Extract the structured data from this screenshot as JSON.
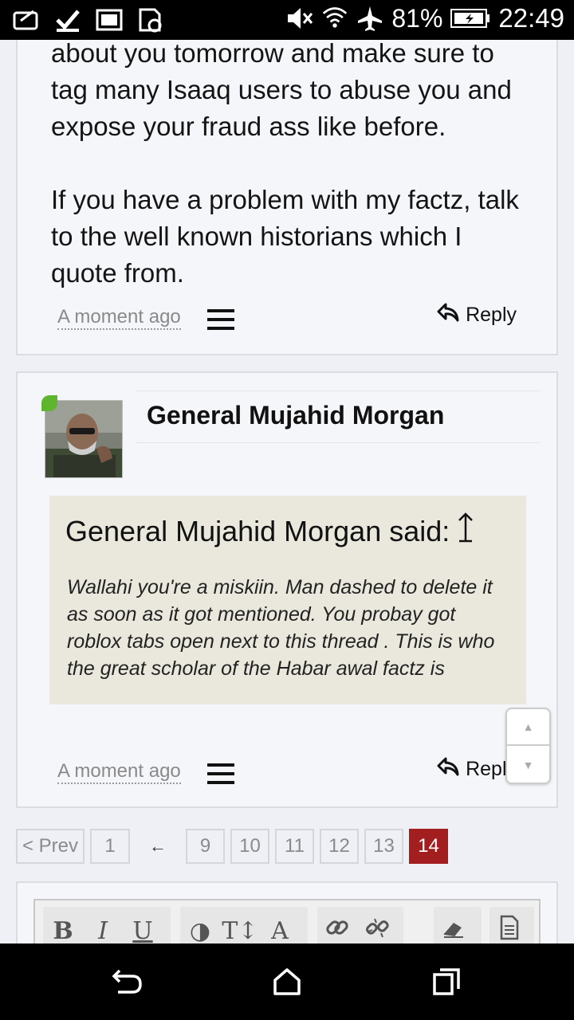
{
  "status_bar": {
    "battery_percent": "81%",
    "time": "22:49",
    "icons": [
      "message-icon",
      "check-icon",
      "image-icon",
      "sd-sync-icon",
      "mute-icon",
      "wifi-icon",
      "airplane-icon",
      "battery-charging-icon"
    ]
  },
  "post1": {
    "paragraphs": [
      "Yusuf Ali Kenadid. I will make a topic about you tomorrow and make sure to tag many Isaaq users to abuse you and expose your fraud ass like before.",
      "If you have a problem with my factz, talk to the well known historians which I quote from."
    ],
    "timestamp": "A moment ago",
    "reply_label": "Reply"
  },
  "post2": {
    "username": "General Mujahid Morgan",
    "quote": {
      "header": "General Mujahid Morgan said:",
      "body": "Wallahi you're a miskiin. Man dashed to delete it as soon as it got mentioned. You probay got roblox tabs open next to this thread . This is who the great scholar of the Habar awal factz is"
    },
    "timestamp": "A moment ago",
    "reply_label": "Reply"
  },
  "pagination": {
    "prev_label": "< Prev",
    "first": "1",
    "ellipsis_arrow": "←",
    "pages": [
      "9",
      "10",
      "11",
      "12",
      "13"
    ],
    "current": "14"
  },
  "editor": {
    "tools": [
      "B",
      "I",
      "U",
      "◑",
      "T↕",
      "A",
      "link-icon",
      "unlink-icon",
      "eraser-icon",
      "document-icon"
    ]
  },
  "nav": {
    "icons": [
      "back-icon",
      "home-icon",
      "recents-icon"
    ]
  }
}
